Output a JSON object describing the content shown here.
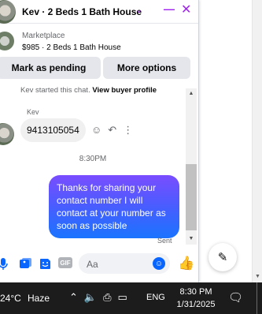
{
  "header": {
    "title": "Kev · 2 Beds 1 Bath House",
    "chevron_icon": "chevron-down-icon",
    "minimize_icon": "minimize-icon",
    "close_icon": "close-icon",
    "accent_color": "#a020f0"
  },
  "listing": {
    "market_label": "Marketplace",
    "price_line": "$985 · 2 Beds 1 Bath House"
  },
  "actions": {
    "mark_pending": "Mark as pending",
    "more_options": "More options"
  },
  "messages": {
    "started_text": "Kev started this chat.",
    "view_profile_link": "View buyer profile",
    "sender_name": "Kev",
    "incoming_text": "9413105054",
    "time_divider": "8:30PM",
    "outgoing_text": "Thanks for sharing your contact number I will contact at your number as soon as possible",
    "status": "Sent"
  },
  "composer": {
    "placeholder": "Aa",
    "gif_label": "GIF",
    "brand_color": "#0866ff"
  },
  "taskbar": {
    "temperature": "24°C",
    "weather": "Haze",
    "language": "ENG",
    "time": "8:30 PM",
    "date": "1/31/2025"
  }
}
